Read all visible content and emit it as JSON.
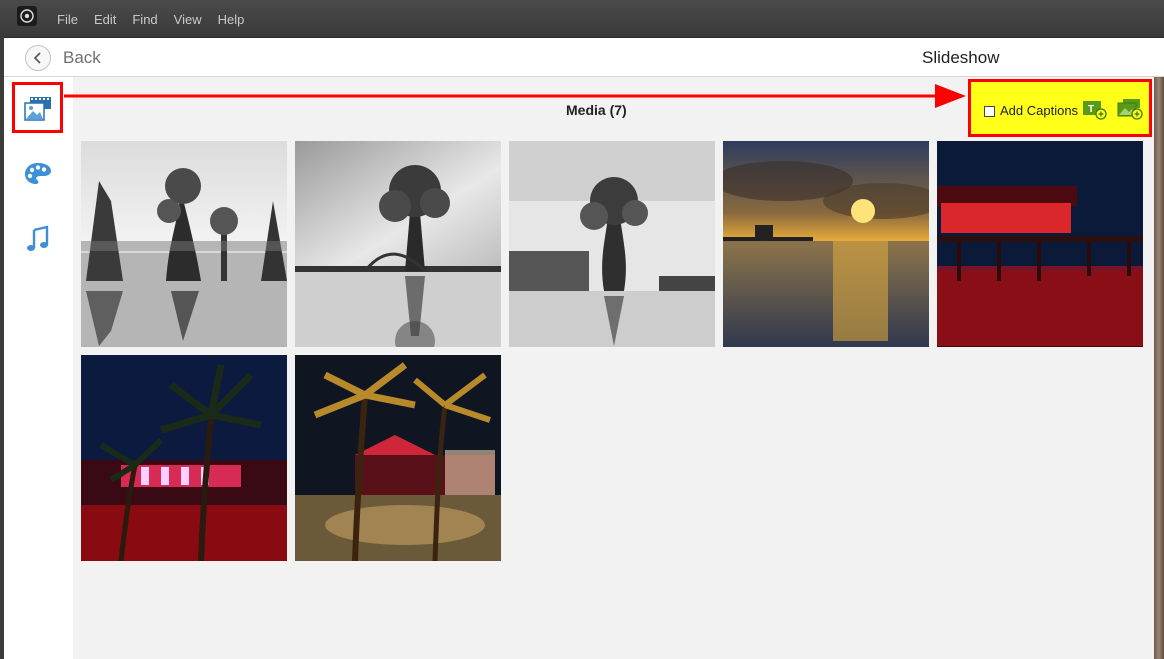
{
  "menu": {
    "items": [
      "File",
      "Edit",
      "Find",
      "View",
      "Help"
    ]
  },
  "header": {
    "back_label": "Back",
    "title": "Slideshow"
  },
  "sidebar": {
    "items": [
      {
        "icon": "media-icon",
        "active": true
      },
      {
        "icon": "palette-icon",
        "active": false
      },
      {
        "icon": "music-icon",
        "active": false
      }
    ]
  },
  "content": {
    "title": "Media (7)",
    "add_captions_label": "Add Captions",
    "add_captions_checked": false,
    "thumbnails": [
      {
        "subject": "black-and-white cypress stumps reflected in a lake"
      },
      {
        "subject": "black-and-white cypress tree under dramatic sky"
      },
      {
        "subject": "black-and-white lone cypress on lake shore"
      },
      {
        "subject": "sunrise over ocean with fishing pier"
      },
      {
        "subject": "pier lit with red lights at night"
      },
      {
        "subject": "palm trees and building with neon lights at night"
      },
      {
        "subject": "palm tree courtyard lit at night"
      }
    ]
  },
  "colors": {
    "highlight_red": "#ff0000",
    "highlight_yellow": "#ffff1a",
    "accent_green": "#5a9a1a",
    "accent_blue": "#2a7ab8"
  }
}
